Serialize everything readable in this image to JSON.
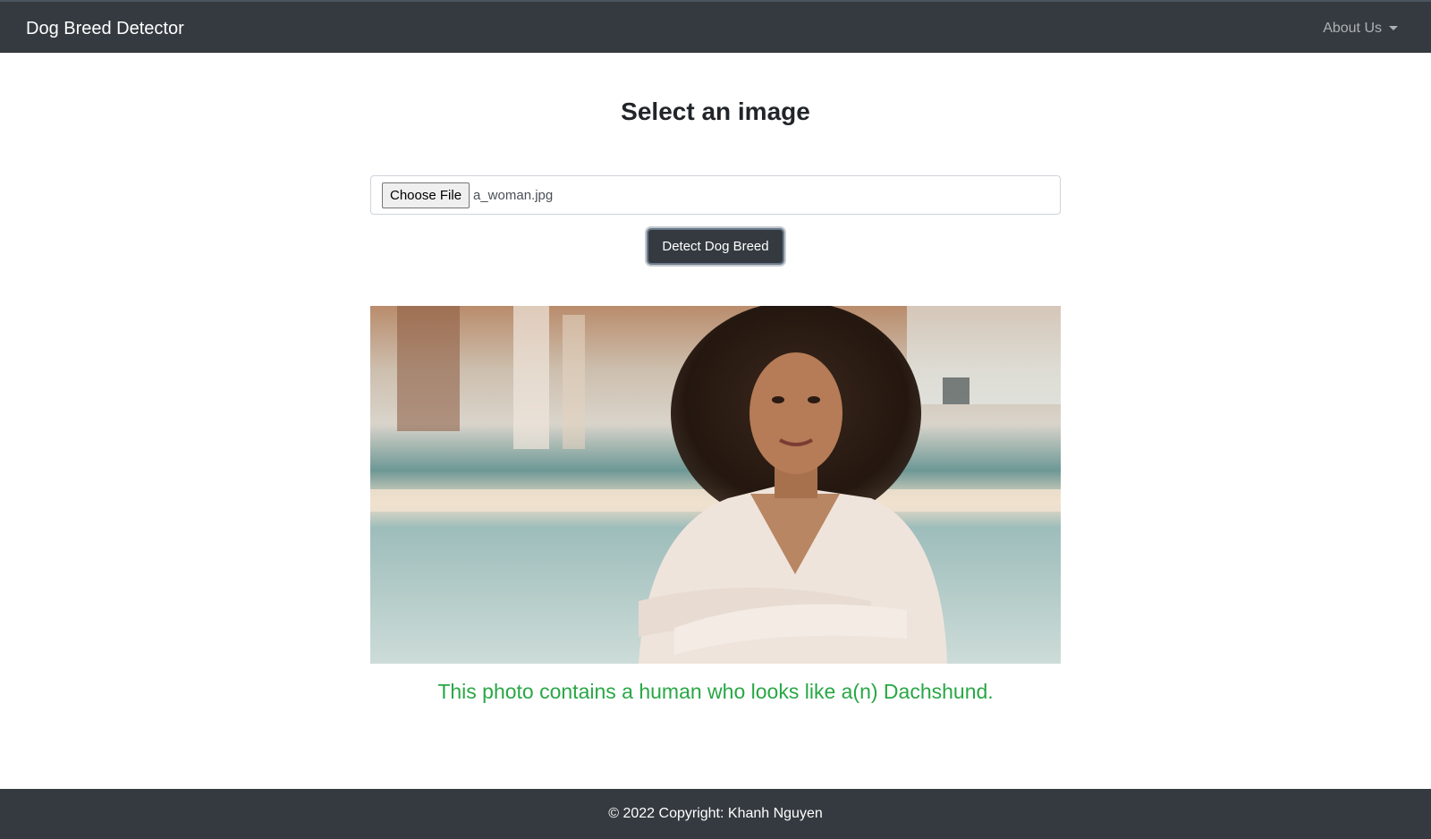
{
  "navbar": {
    "brand": "Dog Breed Detector",
    "about_label": "About Us"
  },
  "main": {
    "title": "Select an image",
    "file_input": {
      "button_label": "Choose File",
      "file_name": "a_woman.jpg"
    },
    "detect_button": "Detect Dog Breed",
    "result_text": "This photo contains a human who looks like a(n) Dachshund."
  },
  "footer": {
    "copyright": "© 2022 Copyright: Khanh Nguyen"
  },
  "colors": {
    "navbar_bg": "#343a40",
    "result_text": "#28a745",
    "button_bg": "#343a40"
  },
  "icons": {
    "dropdown": "caret-down-icon"
  }
}
